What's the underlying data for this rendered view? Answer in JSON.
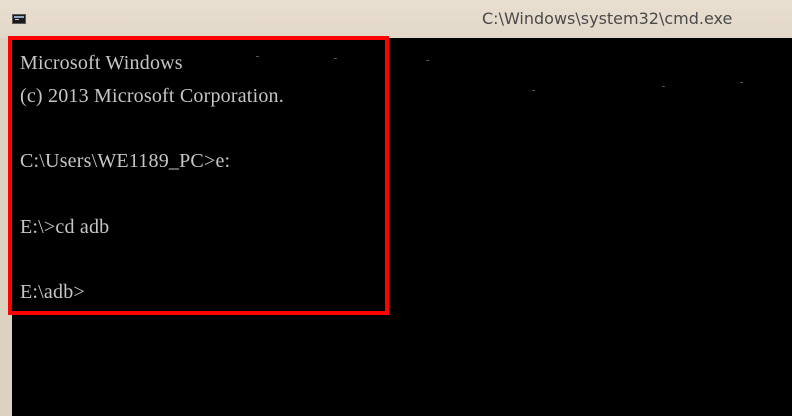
{
  "window": {
    "title": "C:\\Windows\\system32\\cmd.exe",
    "app_icon": "console-icon"
  },
  "console": {
    "lines": [
      "Microsoft Windows",
      "(c) 2013 Microsoft Corporation.",
      "C:\\Users\\WE1189_PC>e:",
      "E:\\>cd adb",
      "E:\\adb>"
    ]
  },
  "colors": {
    "console_background": "#000000",
    "console_text": "#c6c6c6",
    "highlight": "#ff0000",
    "titlebar": "#e5dacb"
  }
}
